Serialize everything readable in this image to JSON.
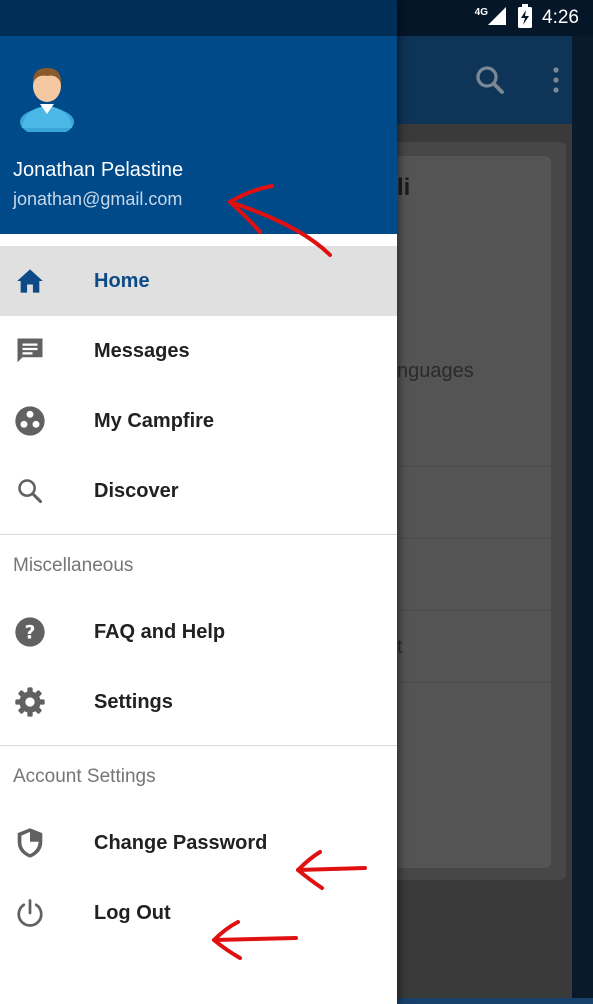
{
  "status_bar": {
    "network": "4G",
    "time": "4:26"
  },
  "background_app": {
    "card_title_fragment": "li",
    "card_text_fragment": "nguages",
    "card_text2_fragment": "t"
  },
  "drawer": {
    "user": {
      "name": "Jonathan Pelastine",
      "email": "jonathan@gmail.com"
    },
    "primary_items": [
      {
        "label": "Home",
        "icon": "home-icon",
        "active": true
      },
      {
        "label": "Messages",
        "icon": "message-icon",
        "active": false
      },
      {
        "label": "My Campfire",
        "icon": "campfire-icon",
        "active": false
      },
      {
        "label": "Discover",
        "icon": "search-icon",
        "active": false
      }
    ],
    "misc_section": {
      "title": "Miscellaneous",
      "items": [
        {
          "label": "FAQ and Help",
          "icon": "help-icon"
        },
        {
          "label": "Settings",
          "icon": "gear-icon"
        }
      ]
    },
    "account_section": {
      "title": "Account Settings",
      "items": [
        {
          "label": "Change Password",
          "icon": "shield-icon"
        },
        {
          "label": "Log Out",
          "icon": "power-icon"
        }
      ]
    }
  },
  "colors": {
    "header": "#004a8a",
    "active_item": "#0d4a86",
    "annotation": "#e01010"
  }
}
